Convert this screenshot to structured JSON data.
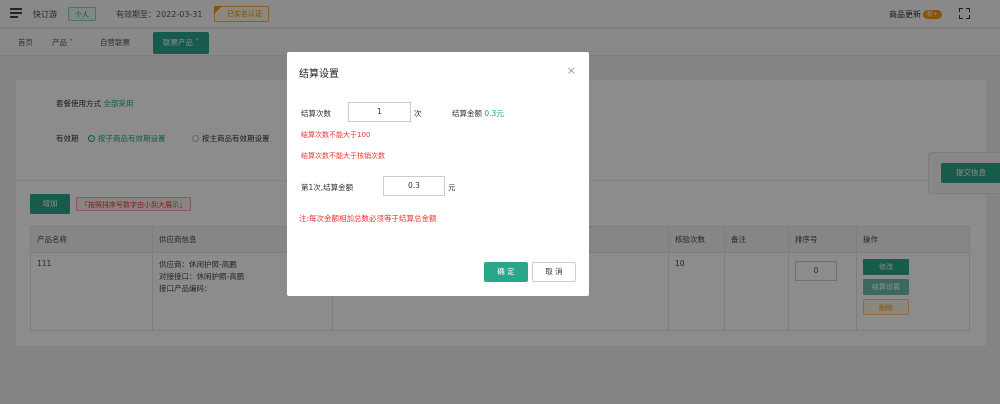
{
  "topbar": {
    "shop_name": "快订游",
    "plan_badge": "个人",
    "expire_text": "有效期至：2022-03-31",
    "verified_label": "已实名认证",
    "update_label": "商品更新",
    "update_badge": "新+"
  },
  "tabs": [
    {
      "label": "首页"
    },
    {
      "label": "产品"
    },
    {
      "label": "自营联票"
    },
    {
      "label": "联票产品"
    }
  ],
  "page": {
    "usage_label": "套餐使用方式",
    "usage_value": "全部采用",
    "validity_label": "有效期",
    "validity_option1": "按子商品有效期设置",
    "validity_option2": "按主商品有效期设置",
    "add_button": "增加",
    "sort_hint": "「按照排序号数字由小到大展示」",
    "submit_button": "提交信息",
    "table": {
      "headers": [
        "产品名称",
        "供应商信息",
        "",
        "核验次数",
        "备注",
        "排序号",
        "操作"
      ],
      "row": {
        "name": "111",
        "supplier_lines": [
          "供应商：休闲护照-高鹏",
          "对接接口：休闲护照-高鹏",
          "接口产品编码："
        ],
        "verify_count": "10",
        "sort_value": "0",
        "actions": [
          "修改",
          "结算设置",
          "删除"
        ]
      }
    }
  },
  "modal": {
    "title": "结算设置",
    "close": "×",
    "count_label": "结算次数",
    "count_value": "1",
    "count_unit": "次",
    "amount_label": "结算金额",
    "amount_value": "0.3元",
    "error1": "结算次数不能大于100",
    "error2": "结算次数不能大于核销次数",
    "first_amount_label": "第1次,结算金额",
    "first_amount_value": "0.3",
    "first_amount_unit": "元",
    "note": "注:每次金额相加总数必须等于结算总金额",
    "confirm": "确 定",
    "cancel": "取 消"
  }
}
